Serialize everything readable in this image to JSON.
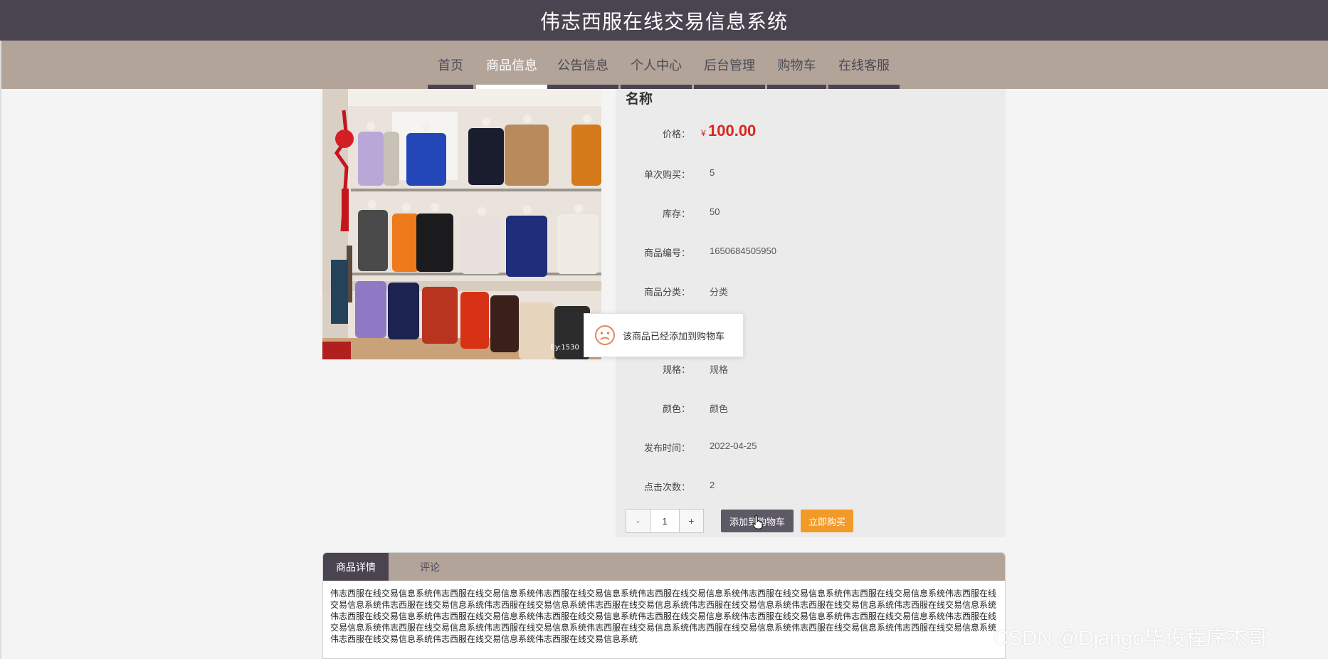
{
  "header": {
    "title": "伟志西服在线交易信息系统"
  },
  "nav": {
    "items": [
      {
        "label": "首页"
      },
      {
        "label": "商品信息"
      },
      {
        "label": "公告信息"
      },
      {
        "label": "个人中心"
      },
      {
        "label": "后台管理"
      },
      {
        "label": "购物车"
      },
      {
        "label": "在线客服"
      }
    ],
    "active_index": 1
  },
  "product": {
    "image_caption": "By:1530",
    "name": "名称",
    "price_label": "价格：",
    "currency": "¥",
    "price": "100.00",
    "fields": [
      {
        "label": "单次购买：",
        "value": "5"
      },
      {
        "label": "库存：",
        "value": "50"
      },
      {
        "label": "商品编号：",
        "value": "1650684505950"
      },
      {
        "label": "商品分类：",
        "value": "分类"
      },
      {
        "label": "规格：",
        "value": "规格"
      },
      {
        "label": "颜色：",
        "value": "颜色"
      },
      {
        "label": "发布时间：",
        "value": "2022-04-25"
      },
      {
        "label": "点击次数：",
        "value": "2"
      }
    ],
    "quantity": {
      "minus": "-",
      "value": "1",
      "plus": "+"
    },
    "add_to_cart_label": "添加到购物车",
    "buy_now_label": "立即购买"
  },
  "toast": {
    "icon": "sad-face-icon",
    "message": "该商品已经添加到购物车"
  },
  "tabs": {
    "items": [
      {
        "label": "商品详情"
      },
      {
        "label": "评论"
      }
    ],
    "active_index": 0,
    "detail_text": "伟志西服在线交易信息系统伟志西服在线交易信息系统伟志西服在线交易信息系统伟志西服在线交易信息系统伟志西服在线交易信息系统伟志西服在线交易信息系统伟志西服在线交易信息系统伟志西服在线交易信息系统伟志西服在线交易信息系统伟志西服在线交易信息系统伟志西服在线交易信息系统伟志西服在线交易信息系统伟志西服在线交易信息系统伟志西服在线交易信息系统伟志西服在线交易信息系统伟志西服在线交易信息系统伟志西服在线交易信息系统伟志西服在线交易信息系统伟志西服在线交易信息系统伟志西服在线交易信息系统伟志西服在线交易信息系统伟志西服在线交易信息系统伟志西服在线交易信息系统伟志西服在线交易信息系统伟志西服在线交易信息系统伟志西服在线交易信息系统伟志西服在线交易信息系统伟志西服在线交易信息系统伟志西服在线交易信息系统"
  },
  "watermark": "CSDN @Django毕设程序杰哥",
  "colors": {
    "header_bg": "#4a4350",
    "nav_bg": "#b3a49a",
    "price": "#d9261c",
    "cart_button": "#5d5a66",
    "buy_button": "#f29a27"
  }
}
